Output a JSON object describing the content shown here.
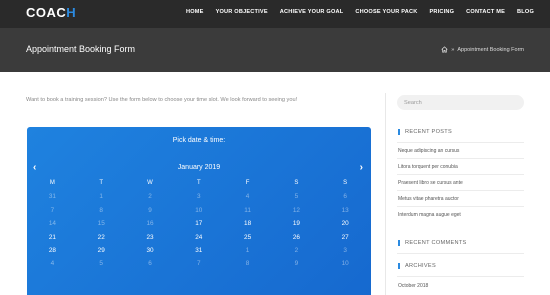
{
  "header": {
    "logo_main": "COAC",
    "logo_accent": "H",
    "nav": [
      "HOME",
      "YOUR OBJECTIVE",
      "ACHIEVE YOUR GOAL",
      "CHOOSE YOUR PACK",
      "PRICING",
      "CONTACT ME",
      "BLOG"
    ]
  },
  "titlebar": {
    "title": "Appointment Booking Form",
    "breadcrumb_sep": "»",
    "breadcrumb_current": "Appointment Booking Form"
  },
  "intro_text": "Want to book a training session? Use the form below to choose your time slot. We look forward to seeing you!",
  "calendar": {
    "heading": "Pick date & time:",
    "month": "January 2019",
    "prev": "‹",
    "next": "›",
    "weekdays": [
      "M",
      "T",
      "W",
      "T",
      "F",
      "S",
      "S"
    ],
    "rows": [
      [
        [
          "31",
          true
        ],
        [
          "1",
          true
        ],
        [
          "2",
          true
        ],
        [
          "3",
          true
        ],
        [
          "4",
          true
        ],
        [
          "5",
          true
        ],
        [
          "6",
          true
        ]
      ],
      [
        [
          "7",
          true
        ],
        [
          "8",
          true
        ],
        [
          "9",
          true
        ],
        [
          "10",
          true
        ],
        [
          "11",
          true
        ],
        [
          "12",
          true
        ],
        [
          "13",
          true
        ]
      ],
      [
        [
          "14",
          true
        ],
        [
          "15",
          true
        ],
        [
          "16",
          true
        ],
        [
          "17",
          false
        ],
        [
          "18",
          false
        ],
        [
          "19",
          false
        ],
        [
          "20",
          false
        ]
      ],
      [
        [
          "21",
          false
        ],
        [
          "22",
          false
        ],
        [
          "23",
          false
        ],
        [
          "24",
          false
        ],
        [
          "25",
          false
        ],
        [
          "26",
          false
        ],
        [
          "27",
          false
        ]
      ],
      [
        [
          "28",
          false
        ],
        [
          "29",
          false
        ],
        [
          "30",
          false
        ],
        [
          "31",
          false
        ],
        [
          "1",
          true
        ],
        [
          "2",
          true
        ],
        [
          "3",
          true
        ]
      ],
      [
        [
          "4",
          true
        ],
        [
          "5",
          true
        ],
        [
          "6",
          true
        ],
        [
          "7",
          true
        ],
        [
          "8",
          true
        ],
        [
          "9",
          true
        ],
        [
          "10",
          true
        ]
      ]
    ]
  },
  "sidebar": {
    "search_placeholder": "Search",
    "recent_posts_title": "RECENT POSTS",
    "recent_posts": [
      "Neque adipiscing an cursus",
      "Litora torquent per conubia",
      "Praesent libro se cursus ante",
      "Metus vitae pharetra auctor",
      "Interdum magna augue eget"
    ],
    "recent_comments_title": "RECENT COMMENTS",
    "archives_title": "ARCHIVES",
    "archives": [
      "October 2018"
    ]
  },
  "colors": {
    "accent": "#2b8ae0",
    "topbar": "#2a2a2a",
    "titlebar": "#3b3b3b",
    "calendar": "#1a76d6"
  }
}
